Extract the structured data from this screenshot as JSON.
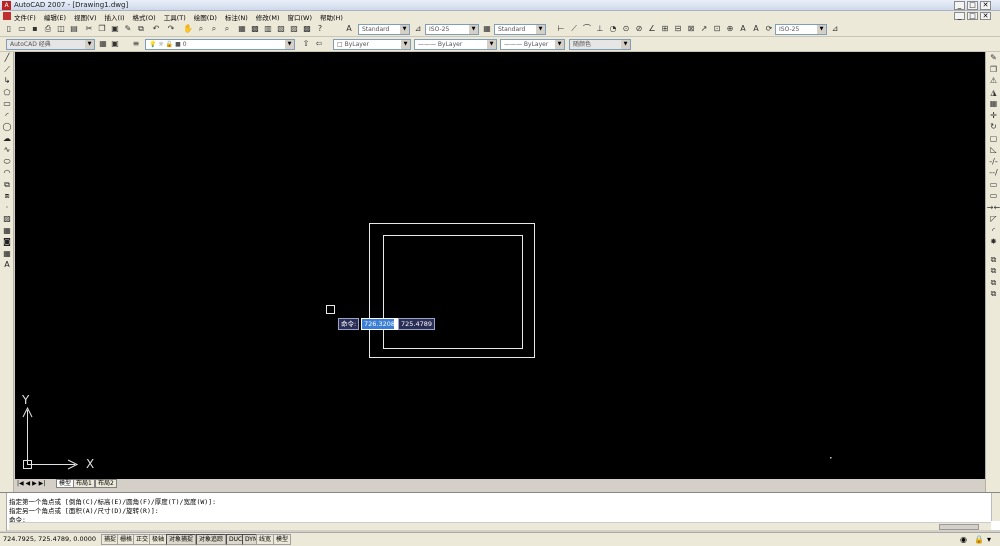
{
  "window": {
    "title": "AutoCAD 2007 - [Drawing1.dwg]",
    "minimize": "_",
    "restore": "□",
    "close": "✕"
  },
  "menus": [
    "文件(F)",
    "编辑(E)",
    "视图(V)",
    "插入(I)",
    "格式(O)",
    "工具(T)",
    "绘图(D)",
    "标注(N)",
    "修改(M)",
    "窗口(W)",
    "帮助(H)"
  ],
  "toolbar1": {
    "text_style": "Standard",
    "dim_style": "ISO-25",
    "table_style": "Standard",
    "multileader_style": "ISO-25"
  },
  "toolbar2": {
    "workspace": "AutoCAD 经典",
    "layer": "0",
    "color": "ByLayer",
    "linetype": "ByLayer",
    "lineweight": "ByLayer",
    "plotstyle": "随颜色"
  },
  "icons": {
    "left_draw": [
      "line-icon",
      "construction-line-icon",
      "polyline-icon",
      "polygon-icon",
      "rectangle-icon",
      "arc-icon",
      "circle-icon",
      "revision-cloud-icon",
      "spline-icon",
      "ellipse-icon",
      "ellipse-arc-icon",
      "insert-block-icon",
      "make-block-icon",
      "point-icon",
      "hatch-icon",
      "gradient-icon",
      "region-icon",
      "table-icon",
      "mtext-icon"
    ],
    "right_modify": [
      "erase-icon",
      "copy-icon",
      "mirror-icon",
      "offset-icon",
      "array-icon",
      "move-icon",
      "rotate-icon",
      "scale-icon",
      "stretch-icon",
      "trim-icon",
      "extend-icon",
      "break-at-point-icon",
      "break-icon",
      "join-icon",
      "chamfer-icon",
      "fillet-icon",
      "explode-icon",
      "draworder-front-icon",
      "draworder-back-icon",
      "draworder-above-icon",
      "draworder-under-icon"
    ]
  },
  "canvas": {
    "ucs_x_label": "X",
    "ucs_y_label": "Y"
  },
  "dynamic_input": {
    "prompt": "命令:",
    "x_value": "726.3208",
    "y_value": "725.4789"
  },
  "layout_tabs": {
    "nav": "|◀ ◀ ▶ ▶|",
    "model": "模型",
    "layout1": "布局1",
    "layout2": "布局2"
  },
  "command": {
    "line1": "指定第一个角点或 [倒角(C)/标高(E)/圆角(F)/厚度(T)/宽度(W)]:",
    "line2": "指定另一个角点或 [面积(A)/尺寸(D)/旋转(R)]:",
    "prompt": "命令:"
  },
  "status": {
    "coords": "724.7925, 725.4789, 0.0000",
    "buttons": [
      "捕捉",
      "栅格",
      "正交",
      "极轴",
      "对象捕捉",
      "对象追踪",
      "DUCS",
      "DYN",
      "线宽",
      "模型"
    ]
  }
}
